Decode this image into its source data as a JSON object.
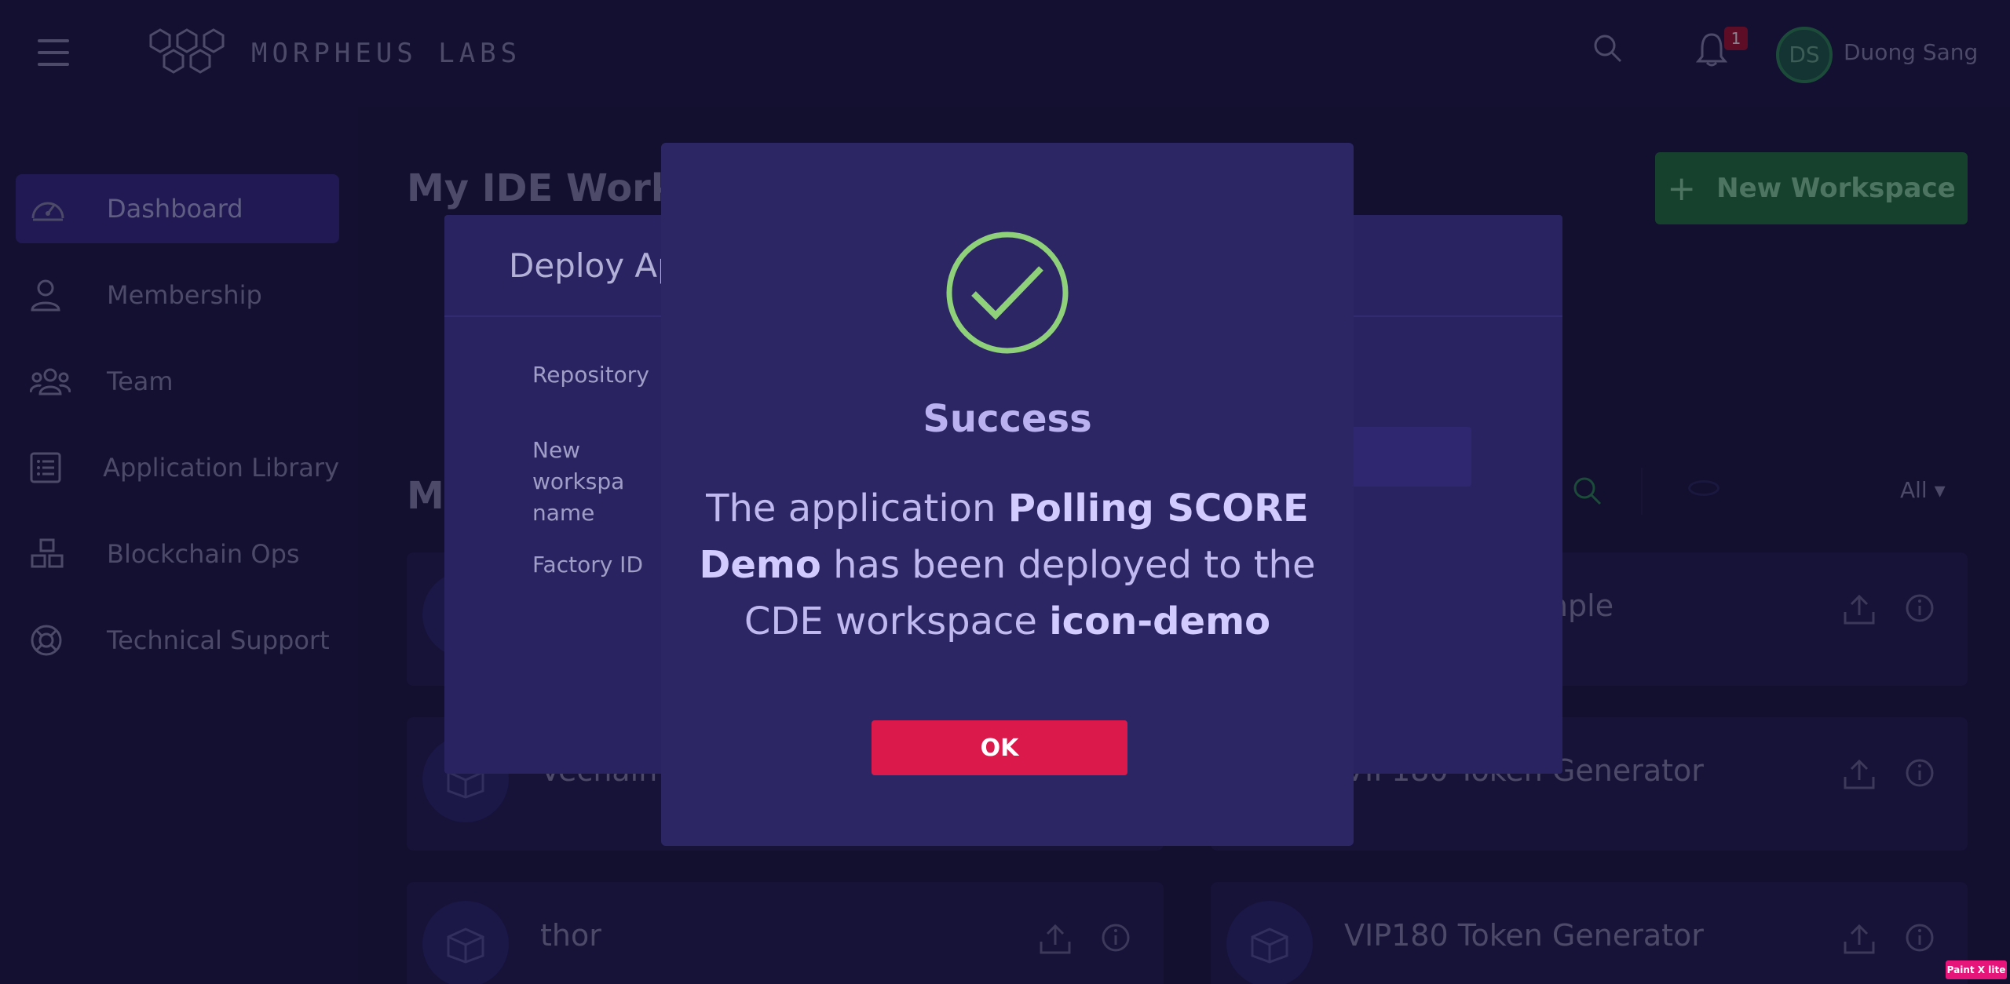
{
  "header": {
    "logo_text": "MORPHEUS LABS",
    "notification_count": "1",
    "user_initials": "DS",
    "user_name": "Duong Sang"
  },
  "sidebar": {
    "items": [
      {
        "label": "Dashboard",
        "icon": "dashboard-icon",
        "active": true
      },
      {
        "label": "Membership",
        "icon": "user-icon",
        "active": false
      },
      {
        "label": "Team",
        "icon": "team-icon",
        "active": false
      },
      {
        "label": "Application Library",
        "icon": "list-icon",
        "active": false
      },
      {
        "label": "Blockchain Ops",
        "icon": "cubes-icon",
        "active": false
      },
      {
        "label": "Technical Support",
        "icon": "lifebuoy-icon",
        "active": false
      }
    ]
  },
  "main": {
    "title": "My IDE Worksp",
    "new_workspace_label": "New Workspace",
    "section_title": "My",
    "filter_label": "All",
    "cards": [
      {
        "title": ""
      },
      {
        "title": "mple"
      },
      {
        "title": "Vechain V"
      },
      {
        "title": "VIP180 Token Generator"
      },
      {
        "title": "thor"
      },
      {
        "title": "VIP180 Token Generator"
      }
    ]
  },
  "deploy_dialog": {
    "title": "Deploy Ap",
    "fields": [
      "Repository",
      "New workspa name",
      "Factory ID"
    ]
  },
  "success_modal": {
    "title": "Success",
    "message_prefix": "The application ",
    "app_name": "Polling SCORE Demo",
    "message_middle": " has been deployed to the CDE workspace ",
    "workspace_name": "icon-demo",
    "ok_label": "OK"
  },
  "watermark": "Paint X lite",
  "colors": {
    "success": "#8fd07a",
    "ok_button": "#db1a4b",
    "new_workspace": "#237a3c",
    "active_nav": "#362b8a"
  }
}
